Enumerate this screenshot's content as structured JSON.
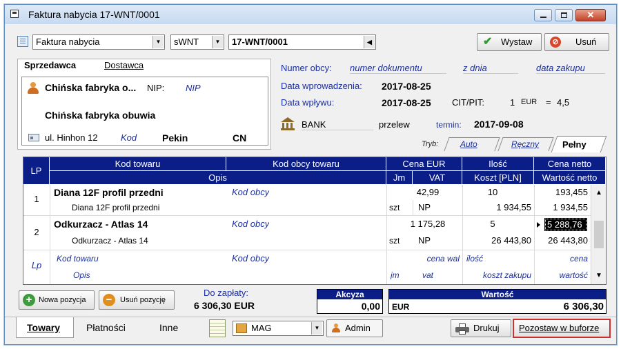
{
  "window": {
    "title": "Faktura nabycia 17-WNT/0001"
  },
  "toolbar": {
    "doc_type": "Faktura nabycia",
    "series": "sWNT",
    "number": "17-WNT/0001",
    "issue_label": "Wystaw",
    "delete_label": "Usuń"
  },
  "party_tabs": {
    "seller": "Sprzedawca",
    "supplier": "Dostawca"
  },
  "seller": {
    "short_name": "Chińska fabryka o...",
    "nip_label": "NIP:",
    "nip_placeholder": "NIP",
    "full_name": "Chińska fabryka obuwia",
    "street": "ul. Hinhon 12",
    "code_placeholder": "Kod",
    "city": "Pekin",
    "country": "CN"
  },
  "meta": {
    "foreign_number_label": "Numer obcy:",
    "foreign_number_ph": "numer dokumentu",
    "from_day_ph": "z dnia",
    "purchase_date_ph": "data zakupu",
    "entry_date_label": "Data wprowadzenia:",
    "entry_date": "2017-08-25",
    "receipt_date_label": "Data wpływu:",
    "receipt_date": "2017-08-25",
    "cit_label": "CIT/PIT:",
    "rate_qty": "1",
    "currency": "EUR",
    "rate_eq": "=",
    "rate_value": "4,5",
    "bank": "BANK",
    "payment_method": "przelew",
    "term_label": "termin:",
    "term_date": "2017-09-08"
  },
  "mode": {
    "label": "Tryb:",
    "tabs": [
      "Auto",
      "Ręczny",
      "Pełny"
    ]
  },
  "grid": {
    "headers_top": {
      "lp": "LP",
      "code": "Kod towaru",
      "foreign_code": "Kod obcy towaru",
      "price": "Cena EUR",
      "qty": "Ilość",
      "net_price": "Cena netto"
    },
    "headers_bottom": {
      "desc": "Opis",
      "unit": "Jm",
      "vat": "VAT",
      "cost": "Koszt [PLN]",
      "net_value": "Wartość netto"
    },
    "rows": [
      {
        "lp": "1",
        "code": "Diana 12F profil przedni",
        "foreign_code": "Kod obcy",
        "price": "42,99",
        "qty": "10",
        "net_price": "193,455",
        "desc": "Diana 12F profil przedni",
        "unit": "szt",
        "vat": "NP",
        "cost": "1 934,55",
        "net_value": "1 934,55"
      },
      {
        "lp": "2",
        "code": "Odkurzacz - Atlas 14",
        "foreign_code": "Kod obcy",
        "price": "1 175,28",
        "qty": "5",
        "net_price": "5 288,76",
        "desc": "Odkurzacz - Atlas 14",
        "unit": "szt",
        "vat": "NP",
        "cost": "26 443,80",
        "net_value": "26 443,80"
      }
    ],
    "new_row": {
      "lp": "Lp",
      "code": "Kod towaru",
      "foreign_code": "Kod obcy",
      "price": "cena wal",
      "qty": "ilość",
      "net_price": "cena",
      "desc": "Opis",
      "unit": "jm",
      "vat": "vat",
      "cost": "koszt zakupu",
      "net_value": "wartość"
    }
  },
  "footer": {
    "new_item_label": "Nowa pozycja",
    "delete_item_label": "Usuń pozycję",
    "to_pay_label": "Do zapłaty:",
    "to_pay_value": "6 306,30 EUR",
    "excise_label": "Akcyza",
    "excise_value": "0,00",
    "value_label": "Wartość",
    "value_currency": "EUR",
    "value_amount": "6 306,30"
  },
  "bottom_tabs": [
    "Towary",
    "Płatności",
    "Inne"
  ],
  "bottom": {
    "warehouse": "MAG",
    "user": "Admin",
    "print_label": "Drukuj",
    "buffer_label": "Pozostaw w buforze"
  }
}
